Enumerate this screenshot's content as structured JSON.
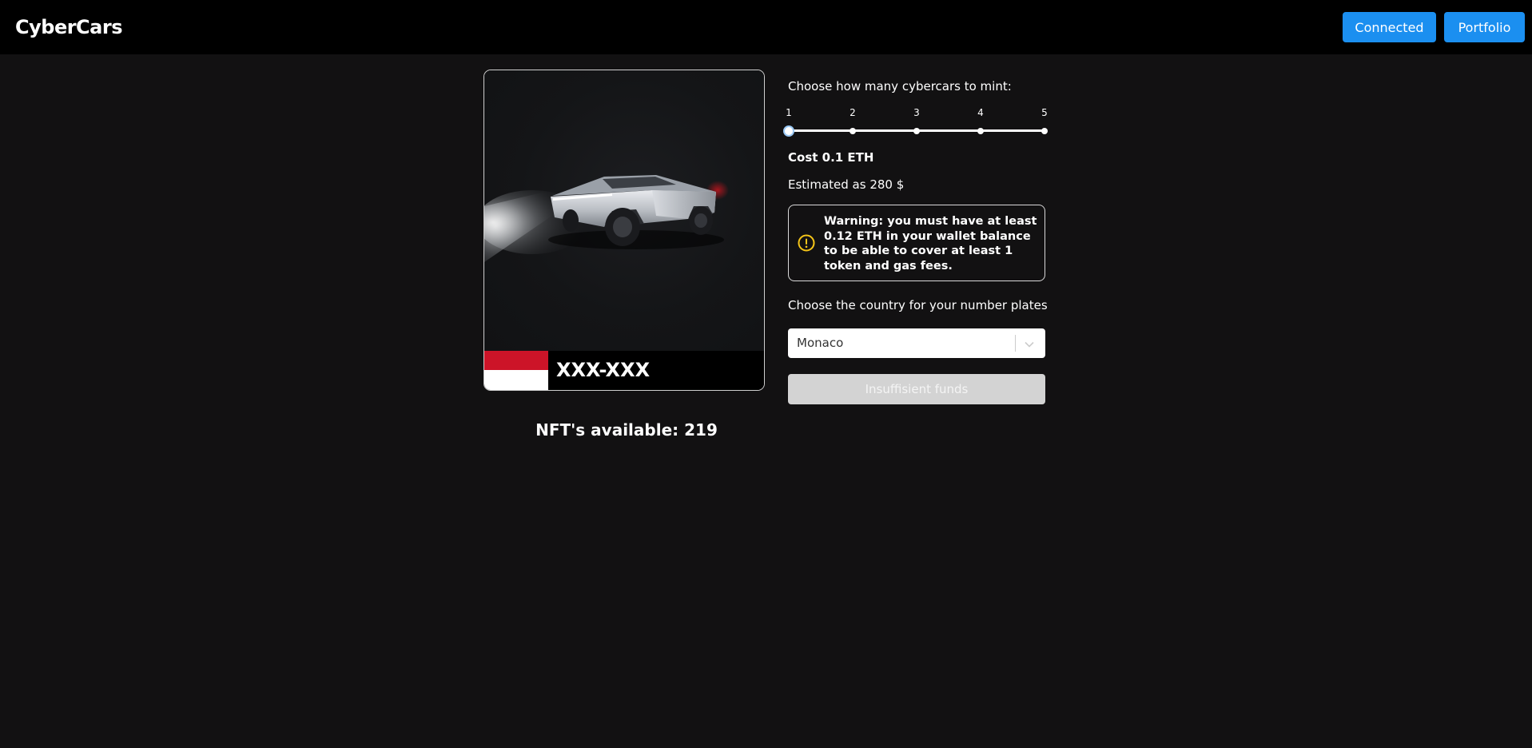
{
  "header": {
    "brand": "CyberCars",
    "connected_label": "Connected",
    "portfolio_label": "Portfolio"
  },
  "card": {
    "plate_text": "XXX-XXX",
    "flag_colors": [
      "#cc1428",
      "#ffffff"
    ],
    "image": "cybertruck-render"
  },
  "available_text": "NFT's available: 219",
  "mint": {
    "label": "Choose how many cybercars to mint:",
    "options": [
      "1",
      "2",
      "3",
      "4",
      "5"
    ],
    "selected": 1,
    "cost_text": "Cost 0.1 ETH",
    "estimate_text": "Estimated as 280 $"
  },
  "warning": {
    "text": "Warning: you must have at least 0.12 ETH in your wallet balance to be able to cover at least 1 token and gas fees.",
    "icon": "exclamation-circle-icon",
    "icon_color": "#f5c518"
  },
  "country": {
    "label": "Choose the country for your number plates",
    "selected": "Monaco"
  },
  "submit_label": "Insuffisient funds",
  "colors": {
    "accent": "#1b8ff0",
    "background": "#121112",
    "header": "#000000"
  }
}
